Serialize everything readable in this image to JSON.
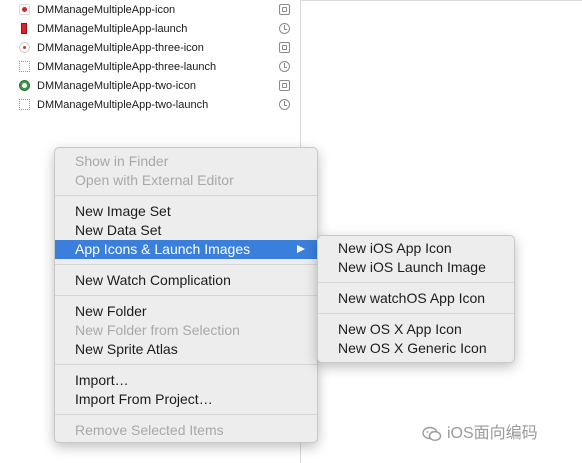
{
  "assets": [
    {
      "name": "DMManageMultipleApp-icon",
      "thumb": "red-dot",
      "type_icon": "app-icon-set-icon"
    },
    {
      "name": "DMManageMultipleApp-launch",
      "thumb": "red-bar",
      "type_icon": "launch-image-icon"
    },
    {
      "name": "DMManageMultipleApp-three-icon",
      "thumb": "grey-dot",
      "type_icon": "app-icon-set-icon"
    },
    {
      "name": "DMManageMultipleApp-three-launch",
      "thumb": "dotted",
      "type_icon": "launch-image-icon"
    },
    {
      "name": "DMManageMultipleApp-two-icon",
      "thumb": "green-dot",
      "type_icon": "app-icon-set-icon"
    },
    {
      "name": "DMManageMultipleApp-two-launch",
      "thumb": "dotted",
      "type_icon": "launch-image-icon"
    }
  ],
  "context_menu": {
    "show_in_finder": "Show in Finder",
    "open_external_editor": "Open with External Editor",
    "new_image_set": "New Image Set",
    "new_data_set": "New Data Set",
    "app_icons_launch_images": "App Icons & Launch Images",
    "new_watch_complication": "New Watch Complication",
    "new_folder": "New Folder",
    "new_folder_from_selection": "New Folder from Selection",
    "new_sprite_atlas": "New Sprite Atlas",
    "import": "Import…",
    "import_from_project": "Import From Project…",
    "remove_selected_items": "Remove Selected Items"
  },
  "submenu": {
    "new_ios_app_icon": "New iOS App Icon",
    "new_ios_launch_image": "New iOS Launch Image",
    "new_watchos_app_icon": "New watchOS App Icon",
    "new_osx_app_icon": "New OS X App Icon",
    "new_osx_generic_icon": "New OS X Generic Icon"
  },
  "watermark": {
    "text": "iOS面向编码"
  },
  "colors": {
    "highlight": "#3a7fdc",
    "menu_bg": "#ededed",
    "disabled_text": "#a8a8a8"
  }
}
